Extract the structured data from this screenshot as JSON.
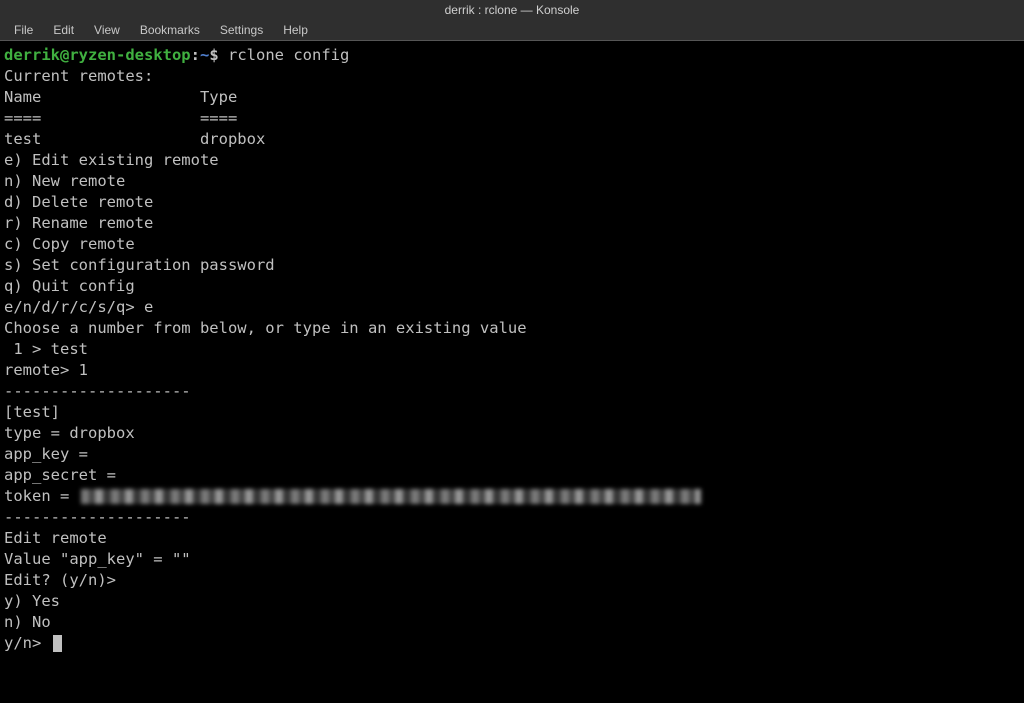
{
  "titlebar": "derrik : rclone — Konsole",
  "menu": {
    "file": "File",
    "edit": "Edit",
    "view": "View",
    "bookmarks": "Bookmarks",
    "settings": "Settings",
    "help": "Help"
  },
  "prompt": {
    "user_host": "derrik@ryzen-desktop",
    "colon": ":",
    "path": "~",
    "marker": "$ "
  },
  "command": "rclone config",
  "lines": {
    "l01": "Current remotes:",
    "l02": "",
    "l03": "Name                 Type",
    "l04": "====                 ====",
    "l05": "test                 dropbox",
    "l06": "",
    "l07": "e) Edit existing remote",
    "l08": "n) New remote",
    "l09": "d) Delete remote",
    "l10": "r) Rename remote",
    "l11": "c) Copy remote",
    "l12": "s) Set configuration password",
    "l13": "q) Quit config",
    "l14": "e/n/d/r/c/s/q> e",
    "l15": "Choose a number from below, or type in an existing value",
    "l16": " 1 > test",
    "l17": "remote> 1",
    "l18": "--------------------",
    "l19": "[test]",
    "l20": "type = dropbox",
    "l21": "app_key = ",
    "l22": "app_secret = ",
    "l23": "token = ",
    "l24": "--------------------",
    "l25": "Edit remote",
    "l26": "Value \"app_key\" = \"\"",
    "l27": "Edit? (y/n)>",
    "l28": "y) Yes",
    "l29": "n) No",
    "l30": "y/n> "
  }
}
